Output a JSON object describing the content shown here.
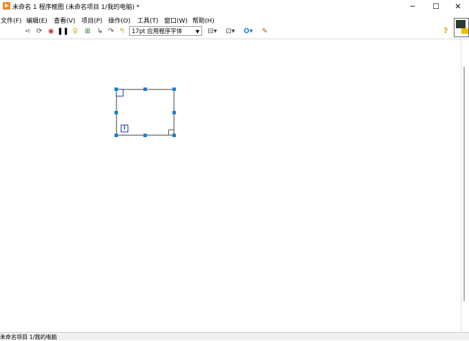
{
  "window": {
    "title": "未命名 1 程序框图 (未命名项目 1/我的电脑) *",
    "minimize_glyph": "─",
    "maximize_glyph": "☐",
    "close_glyph": "✕"
  },
  "menu": {
    "items": [
      "文件(F)",
      "编辑(E)",
      "查看(V)",
      "项目(P)",
      "操作(O)",
      "工具(T)",
      "窗口(W)",
      "帮助(H)"
    ]
  },
  "toolbar": {
    "font_select": "17pt 应用程序字体",
    "icons": [
      "run-arrow-icon",
      "run-continuously-icon",
      "abort-icon",
      "pause-icon",
      "highlight-execution-icon",
      "retain-wire-values-icon",
      "step-into-icon",
      "step-over-icon",
      "step-out-icon",
      "align-icon",
      "distribute-icon",
      "reorder-icon",
      "cleanup-diagram-icon",
      "help-icon"
    ]
  },
  "diagram": {
    "iteration_label": "i"
  },
  "status": {
    "text": "未命名项目 1/我的电脑"
  },
  "colors": {
    "accent": "#1b7ed6",
    "terminal": "#1b3eb8",
    "app_icon": "#f08a1c"
  }
}
